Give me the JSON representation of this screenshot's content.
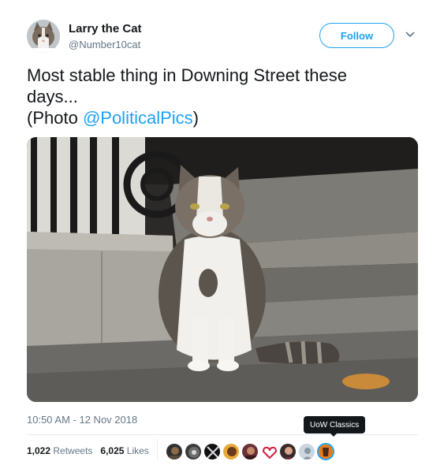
{
  "author": {
    "display_name": "Larry the Cat",
    "handle": "@Number10cat",
    "avatar_icon": "cat-avatar"
  },
  "follow_label": "Follow",
  "tweet": {
    "line1": "Most stable thing in Downing Street these",
    "line2": "days...",
    "line3_prefix": "(Photo ",
    "mention": "@PoliticalPics",
    "line3_suffix": ")"
  },
  "timestamp": "10:50 AM - 12 Nov 2018",
  "stats": {
    "retweets_count": "1,022",
    "retweets_label": "Retweets",
    "likes_count": "6,025",
    "likes_label": "Likes"
  },
  "tooltip": "UoW Classics",
  "colors": {
    "accent": "#1da1f2",
    "text": "#14171a",
    "secondary": "#657786"
  }
}
